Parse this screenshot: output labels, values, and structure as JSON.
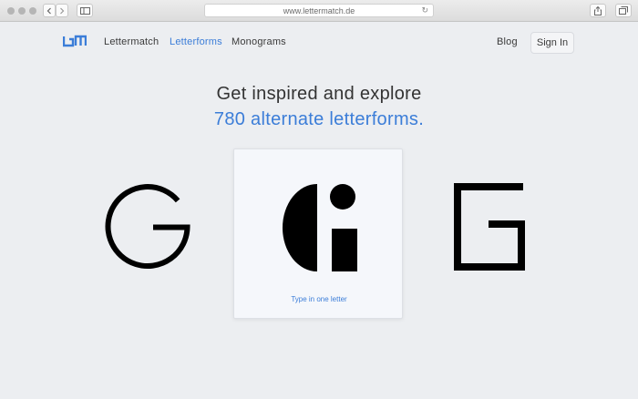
{
  "browser": {
    "url": "www.lettermatch.de",
    "reload_icon": "↻"
  },
  "nav": {
    "brand": "Lettermatch",
    "letterforms": "Letterforms",
    "monograms": "Monograms",
    "blog": "Blog",
    "sign_in": "Sign In"
  },
  "hero": {
    "line1": "Get inspired and explore",
    "line2": "780 alternate letterforms."
  },
  "showcase": {
    "input_hint": "Type in one letter"
  },
  "colors": {
    "accent": "#3b7dd8",
    "page_bg": "#eceef1"
  }
}
